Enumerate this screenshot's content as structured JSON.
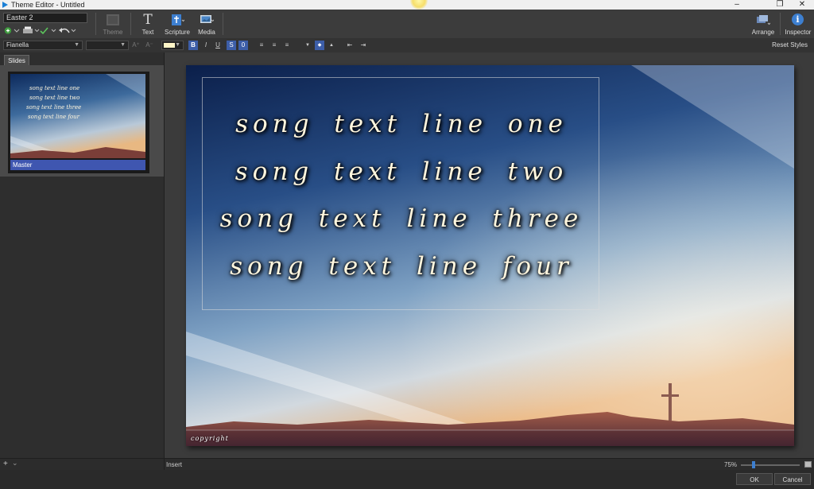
{
  "window": {
    "title": "Theme Editor - Untitled",
    "restore_glyph": "❐",
    "close_glyph": "✕"
  },
  "toolbar": {
    "document_name": "Easter 2",
    "buttons": [
      {
        "label": "Theme",
        "icon": "theme-icon",
        "disabled": true
      },
      {
        "label": "Text",
        "icon": "text-icon"
      },
      {
        "label": "Scripture",
        "icon": "scripture-icon"
      },
      {
        "label": "Media",
        "icon": "media-icon"
      }
    ],
    "arrange_label": "Arrange",
    "inspector_label": "Inspector",
    "inspector_glyph": "i",
    "text_glyph": "T"
  },
  "format": {
    "font": "Fianella",
    "size": "",
    "grow_label": "A⁺",
    "shrink_label": "A⁻",
    "bold": "B",
    "italic": "I",
    "underline": "U",
    "strike": "S",
    "zero": "0",
    "reset_styles": "Reset Styles",
    "font_color": "#fff6c8"
  },
  "left_panel": {
    "tab_label": "Slides",
    "thumb_label": "Master",
    "add_glyph": "+",
    "add_arrow": "⌄"
  },
  "slide": {
    "lines": [
      "song text line one",
      "song text line two",
      "song text line three",
      "song text line four"
    ],
    "copyright": "copyright"
  },
  "status": {
    "insert": "Insert",
    "zoom": "75%"
  },
  "dialog": {
    "ok": "OK",
    "cancel": "Cancel"
  },
  "colors": {
    "accent": "#3f56b0",
    "text_fill": "#fff6de"
  }
}
